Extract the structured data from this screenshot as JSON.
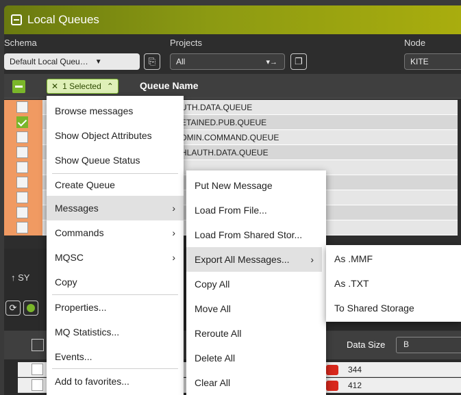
{
  "window": {
    "title": "Local Queues"
  },
  "toolbar": {
    "schema_label": "Schema",
    "schema_value": "Default Local Queu…",
    "projects_label": "Projects",
    "projects_value": "All",
    "node_label": "Node",
    "node_value": "KITE"
  },
  "grid": {
    "selected_label": "1 Selected",
    "column_header": "Queue Name",
    "rows": [
      {
        "name": "UTH.DATA.QUEUE",
        "checked": false
      },
      {
        "name": "ETAINED.PUB.QUEUE",
        "checked": true
      },
      {
        "name": "DMIN.COMMAND.QUEUE",
        "checked": false
      },
      {
        "name": "HLAUTH.DATA.QUEUE",
        "checked": false
      },
      {
        "name": "",
        "checked": false
      },
      {
        "name": "",
        "checked": false
      },
      {
        "name": "",
        "checked": false
      },
      {
        "name": "",
        "checked": false
      },
      {
        "name": "",
        "checked": false
      }
    ]
  },
  "lower": {
    "partial_label": "↑ SY",
    "data_size_label": "Data Size",
    "data_size_unit": "B",
    "values": [
      "344",
      "412"
    ]
  },
  "context_menu": {
    "items": [
      "Browse messages",
      "Show Object Attributes",
      "Show Queue Status",
      "Create Queue",
      "Messages",
      "Commands",
      "MQSC",
      "Copy",
      "Properties...",
      "MQ Statistics...",
      "Events...",
      "Add to favorites..."
    ]
  },
  "messages_submenu": {
    "items": [
      "Put New Message",
      "Load From File...",
      "Load From Shared Stor...",
      "Export All Messages...",
      "Copy All",
      "Move All",
      "Reroute All",
      "Delete All",
      "Clear All"
    ]
  },
  "export_submenu": {
    "items": [
      "As .MMF",
      "As .TXT",
      "To Shared Storage"
    ]
  },
  "colors": {
    "accent": "#7ab62a",
    "title_gradient_end": "#a9ad0e",
    "row_marker": "#f09a62"
  }
}
